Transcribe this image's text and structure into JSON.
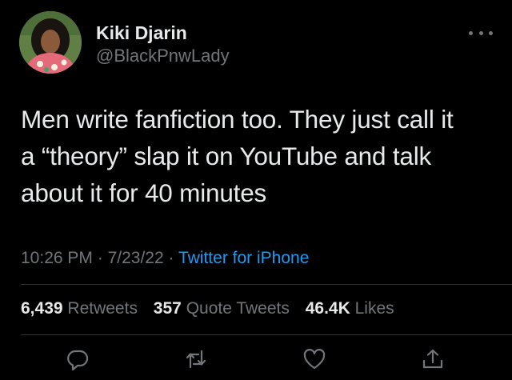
{
  "user": {
    "name": "Kiki Djarin",
    "handle": "@BlackPnwLady"
  },
  "tweet": {
    "text_lines": [
      "Men write fanfiction too. They just call it",
      "a “theory” slap it on YouTube and talk",
      "about it for 40 minutes"
    ],
    "time": "10:26 PM",
    "date": "7/23/22",
    "separator": "·",
    "source": "Twitter for iPhone"
  },
  "stats": {
    "retweets_count": "6,439",
    "retweets_label": "Retweets",
    "quotes_count": "357",
    "quotes_label": "Quote Tweets",
    "likes_count": "46.4K",
    "likes_label": "Likes"
  },
  "actions": {
    "reply": "reply-icon",
    "retweet": "retweet-icon",
    "like": "heart-icon",
    "share": "share-icon"
  },
  "colors": {
    "background": "#000000",
    "text": "#e7e9ea",
    "muted": "#71767b",
    "link": "#1d9bf0",
    "divider": "#2f3336"
  }
}
